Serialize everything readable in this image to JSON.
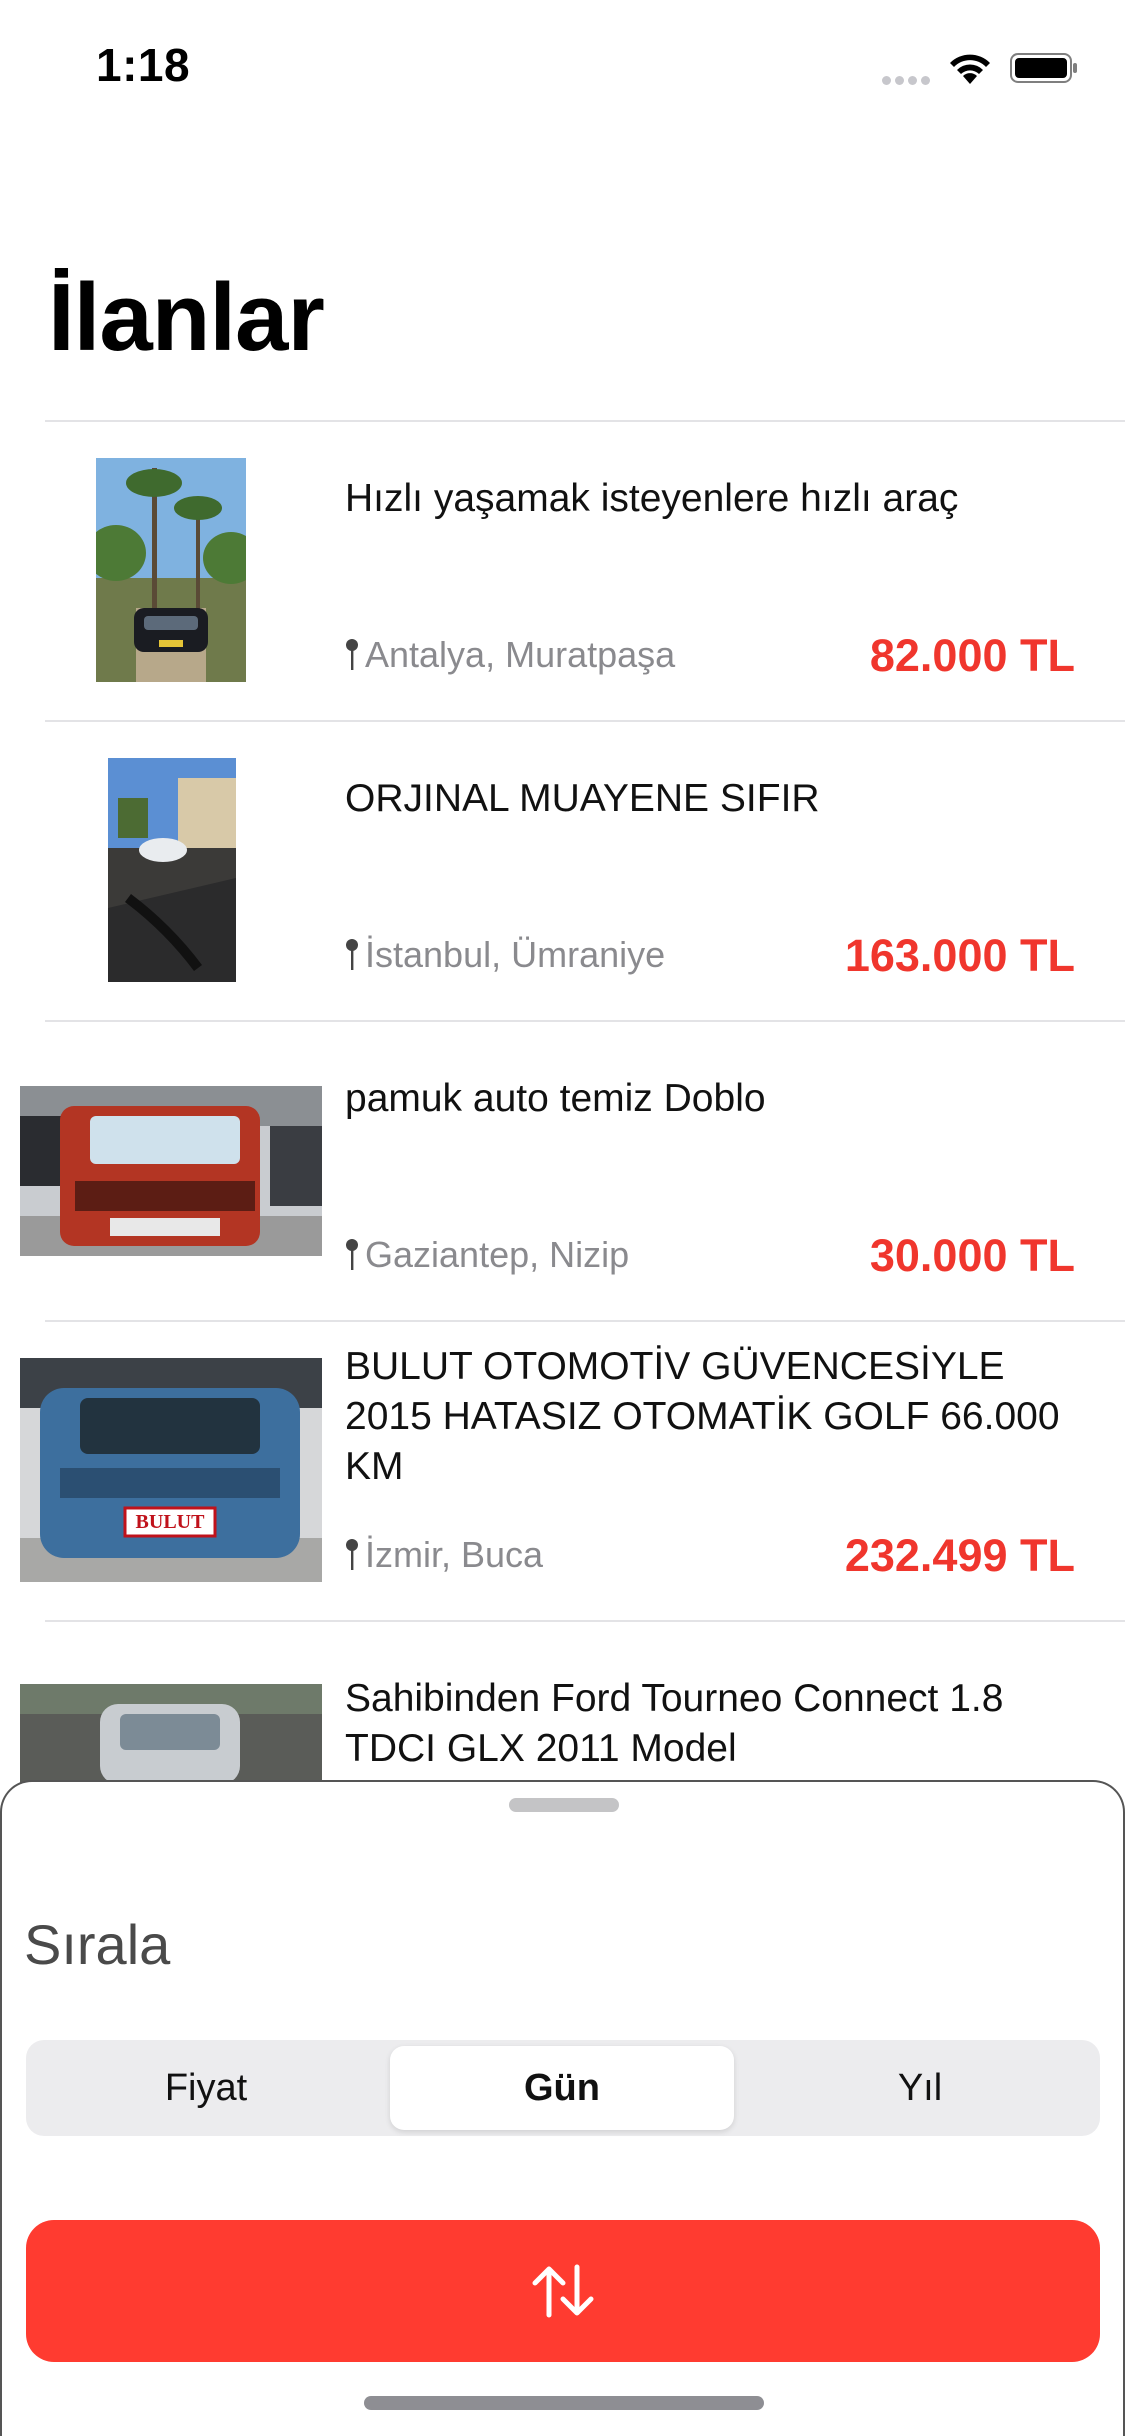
{
  "status_bar": {
    "time": "1:18"
  },
  "page_title": "İlanlar",
  "listings": [
    {
      "title": "Hızlı yaşamak isteyenlere hızlı araç",
      "location": "Antalya, Muratpaşa",
      "price": "82.000 TL"
    },
    {
      "title": "ORJINAL  MUAYENE SIFIR",
      "location": "İstanbul, Ümraniye",
      "price": "163.000 TL"
    },
    {
      "title": "pamuk auto temiz Doblo",
      "location": "Gaziantep, Nizip",
      "price": "30.000 TL"
    },
    {
      "title": "BULUT OTOMOTİV GÜVENCESİYLE 2015 HATASIZ OTOMATİK GOLF 66.000 KM",
      "location": "İzmir, Buca",
      "price": "232.499 TL",
      "badge_text": "BULUT"
    },
    {
      "title": "Sahibinden Ford Tourneo Connect 1.8 TDCI GLX 2011 Model"
    }
  ],
  "sort_sheet": {
    "title": "Sırala",
    "options": [
      "Fiyat",
      "Gün",
      "Yıl"
    ],
    "selected": "Gün",
    "action_icon": "sort-arrows-icon"
  },
  "colors": {
    "accent": "#ff3b30",
    "price": "#f0362d"
  }
}
